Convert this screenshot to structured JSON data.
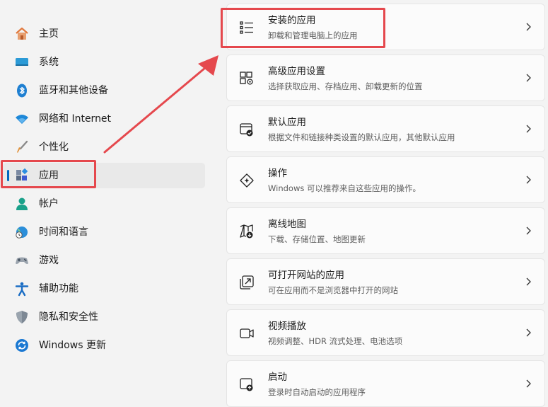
{
  "sidebar": {
    "items": [
      {
        "label": "主页",
        "icon": "home-icon",
        "name": "sidebar-item-home"
      },
      {
        "label": "系统",
        "icon": "system-display-icon",
        "name": "sidebar-item-system"
      },
      {
        "label": "蓝牙和其他设备",
        "icon": "bluetooth-icon",
        "name": "sidebar-item-bluetooth"
      },
      {
        "label": "网络和 Internet",
        "icon": "wifi-icon",
        "name": "sidebar-item-network"
      },
      {
        "label": "个性化",
        "icon": "brush-icon",
        "name": "sidebar-item-personalization"
      },
      {
        "label": "应用",
        "icon": "apps-icon",
        "name": "sidebar-item-apps",
        "selected": true
      },
      {
        "label": "帐户",
        "icon": "account-icon",
        "name": "sidebar-item-accounts"
      },
      {
        "label": "时间和语言",
        "icon": "time-language-icon",
        "name": "sidebar-item-time-language"
      },
      {
        "label": "游戏",
        "icon": "gamepad-icon",
        "name": "sidebar-item-gaming"
      },
      {
        "label": "辅助功能",
        "icon": "accessibility-icon",
        "name": "sidebar-item-accessibility"
      },
      {
        "label": "隐私和安全性",
        "icon": "shield-icon",
        "name": "sidebar-item-privacy"
      },
      {
        "label": "Windows 更新",
        "icon": "windows-update-icon",
        "name": "sidebar-item-windows-update"
      }
    ]
  },
  "main": {
    "cards": [
      {
        "title": "安装的应用",
        "desc": "卸载和管理电脑上的应用",
        "icon": "list-icon",
        "name": "installed-apps"
      },
      {
        "title": "高级应用设置",
        "desc": "选择获取应用、存档应用、卸载更新的位置",
        "icon": "advanced-app-settings-icon",
        "name": "advanced-app-settings"
      },
      {
        "title": "默认应用",
        "desc": "根据文件和链接种类设置的默认应用，其他默认应用",
        "icon": "default-apps-icon",
        "name": "default-apps"
      },
      {
        "title": "操作",
        "desc": "Windows 可以推荐来自这些应用的操作。",
        "icon": "actions-icon",
        "name": "actions"
      },
      {
        "title": "离线地图",
        "desc": "下载、存储位置、地图更新",
        "icon": "offline-map-icon",
        "name": "offline-maps"
      },
      {
        "title": "可打开网站的应用",
        "desc": "可在应用而不是浏览器中打开的网站",
        "icon": "open-website-icon",
        "name": "apps-for-websites"
      },
      {
        "title": "视频播放",
        "desc": "视频调整、HDR 流式处理、电池选项",
        "icon": "video-camera-icon",
        "name": "video-playback"
      },
      {
        "title": "启动",
        "desc": "登录时自动启动的应用程序",
        "icon": "startup-icon",
        "name": "startup"
      }
    ]
  },
  "colors": {
    "accent": "#0067c0",
    "highlight": "#e5484d"
  }
}
